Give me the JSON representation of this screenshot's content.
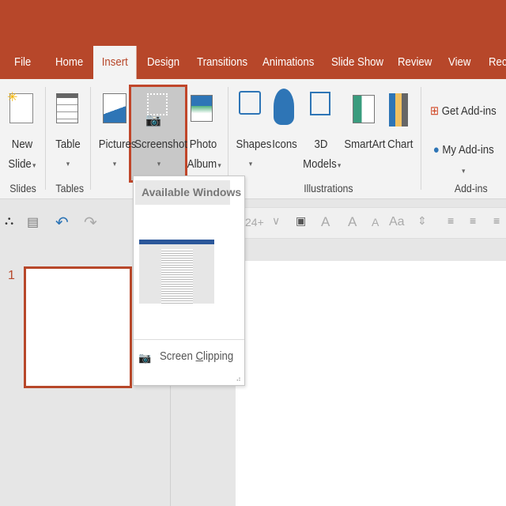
{
  "tabs": [
    {
      "label": "File"
    },
    {
      "label": "Home"
    },
    {
      "label": "Insert",
      "selected": true
    },
    {
      "label": "Design"
    },
    {
      "label": "Transitions"
    },
    {
      "label": "Animations"
    },
    {
      "label": "Slide Show"
    },
    {
      "label": "Review"
    },
    {
      "label": "View"
    },
    {
      "label": "Rec"
    }
  ],
  "ribbon": {
    "new_slide": {
      "l1": "New",
      "l2": "Slide"
    },
    "table": "Table",
    "pictures": "Pictures",
    "screenshot": "Screenshot",
    "photo_album": {
      "l1": "Photo",
      "l2": "Album"
    },
    "shapes": "Shapes",
    "icons": "Icons",
    "models": {
      "l1": "3D",
      "l2": "Models"
    },
    "smartart": "SmartArt",
    "chart": "Chart",
    "get_addins": "Get Add-ins",
    "my_addins": "My Add-ins",
    "groups": {
      "slides": "Slides",
      "tables": "Tables",
      "illustrations": "Illustrations",
      "addins": "Add-ins"
    }
  },
  "format": {
    "font_size": "24+",
    "change_case": "Aa"
  },
  "slides": [
    {
      "number": "1"
    }
  ],
  "dropdown": {
    "header": "Available Windows",
    "clip_pre": "Screen ",
    "clip_u": "C",
    "clip_post": "lipping"
  },
  "colors": {
    "accent": "#b7472a"
  }
}
